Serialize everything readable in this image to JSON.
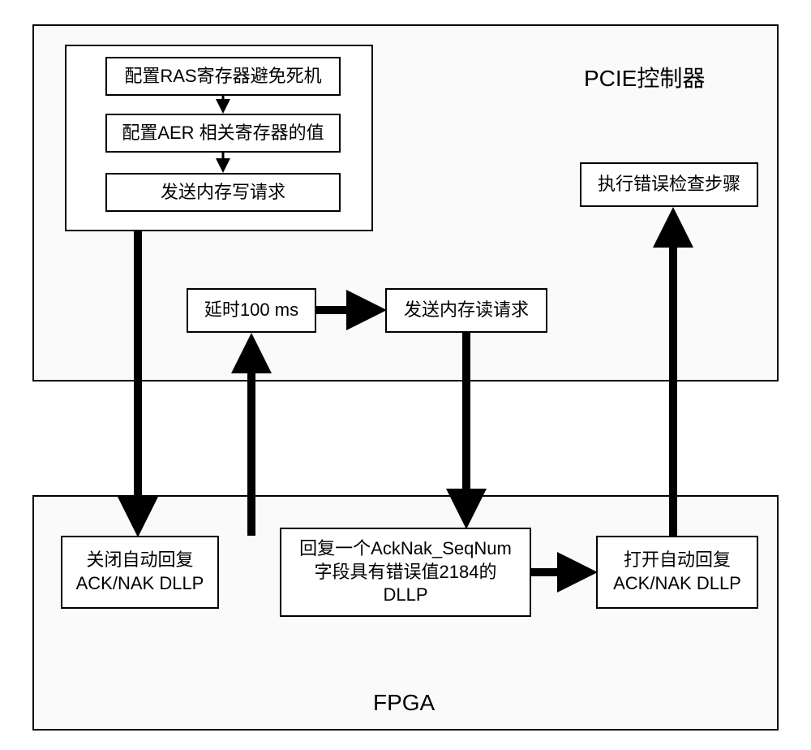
{
  "labels": {
    "pcie": "PCIE控制器",
    "fpga": "FPGA"
  },
  "boxes": {
    "config_ras": "配置RAS寄存器避免死机",
    "config_aer": "配置AER 相关寄存器的值",
    "send_write": "发送内存写请求",
    "delay": "延时100 ms",
    "send_read": "发送内存读请求",
    "exec_check": "执行错误检查步骤",
    "close_auto": "关闭自动回复\nACK/NAK DLLP",
    "reply_dllp": "回复一个AckNak_SeqNum\n字段具有错误值2184的\nDLLP",
    "open_auto": "打开自动回复\nACK/NAK DLLP"
  },
  "chart_data": {
    "type": "flowchart",
    "containers": [
      {
        "id": "pcie",
        "label": "PCIE控制器",
        "nodes": [
          "config_ras",
          "config_aer",
          "send_write",
          "delay",
          "send_read",
          "exec_check"
        ]
      },
      {
        "id": "fpga",
        "label": "FPGA",
        "nodes": [
          "close_auto",
          "reply_dllp",
          "open_auto"
        ]
      }
    ],
    "nodes": [
      {
        "id": "config_ras",
        "label": "配置RAS寄存器避免死机"
      },
      {
        "id": "config_aer",
        "label": "配置AER 相关寄存器的值"
      },
      {
        "id": "send_write",
        "label": "发送内存写请求"
      },
      {
        "id": "delay",
        "label": "延时100 ms"
      },
      {
        "id": "send_read",
        "label": "发送内存读请求"
      },
      {
        "id": "exec_check",
        "label": "执行错误检查步骤"
      },
      {
        "id": "close_auto",
        "label": "关闭自动回复 ACK/NAK DLLP"
      },
      {
        "id": "reply_dllp",
        "label": "回复一个AckNak_SeqNum 字段具有错误值2184的 DLLP"
      },
      {
        "id": "open_auto",
        "label": "打开自动回复 ACK/NAK DLLP"
      }
    ],
    "edges": [
      {
        "from": "config_ras",
        "to": "config_aer"
      },
      {
        "from": "config_aer",
        "to": "send_write"
      },
      {
        "from": "send_write_group",
        "to": "close_auto"
      },
      {
        "from": "close_auto",
        "to": "delay"
      },
      {
        "from": "delay",
        "to": "send_read"
      },
      {
        "from": "send_read",
        "to": "reply_dllp"
      },
      {
        "from": "reply_dllp",
        "to": "open_auto"
      },
      {
        "from": "open_auto",
        "to": "exec_check"
      }
    ]
  }
}
